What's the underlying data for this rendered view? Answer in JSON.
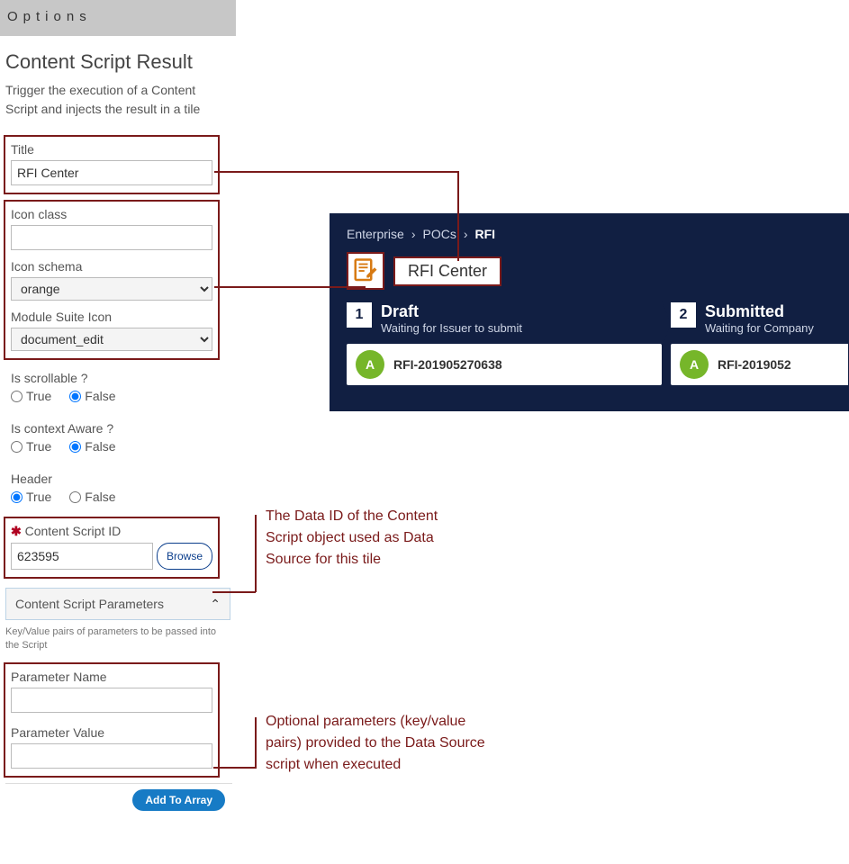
{
  "header": "Options",
  "section": {
    "title": "Content Script Result",
    "desc": "Trigger the execution of a Content Script and injects the result in a tile"
  },
  "fields": {
    "title_label": "Title",
    "title_value": "RFI Center",
    "iconclass_label": "Icon class",
    "iconclass_value": "",
    "iconschema_label": "Icon schema",
    "iconschema_value": "orange",
    "moduleicon_label": "Module Suite Icon",
    "moduleicon_value": "document_edit",
    "scrollable_label": "Is scrollable ?",
    "context_label": "Is context Aware ?",
    "header_label": "Header",
    "true_label": "True",
    "false_label": "False",
    "csid_label": "Content Script ID",
    "csid_value": "623595",
    "browse_label": "Browse",
    "accordion_label": "Content Script Parameters",
    "params_hint": "Key/Value pairs of parameters to be passed into the Script",
    "pname_label": "Parameter Name",
    "pvalue_label": "Parameter Value",
    "addarray_label": "Add To Array"
  },
  "preview": {
    "crumbs": [
      "Enterprise",
      "POCs",
      "RFI"
    ],
    "page_title": "RFI Center",
    "stages": [
      {
        "num": "1",
        "title": "Draft",
        "sub": "Waiting for Issuer to submit",
        "rfi": "RFI-201905270638",
        "avatar": "A"
      },
      {
        "num": "2",
        "title": "Submitted",
        "sub": "Waiting for Company",
        "rfi": "RFI-2019052",
        "avatar": "A"
      }
    ]
  },
  "annotations": {
    "csid": "The Data ID of the Content Script object used as Data Source for this tile",
    "params": "Optional parameters (key/value pairs) provided to the Data Source script when executed"
  }
}
